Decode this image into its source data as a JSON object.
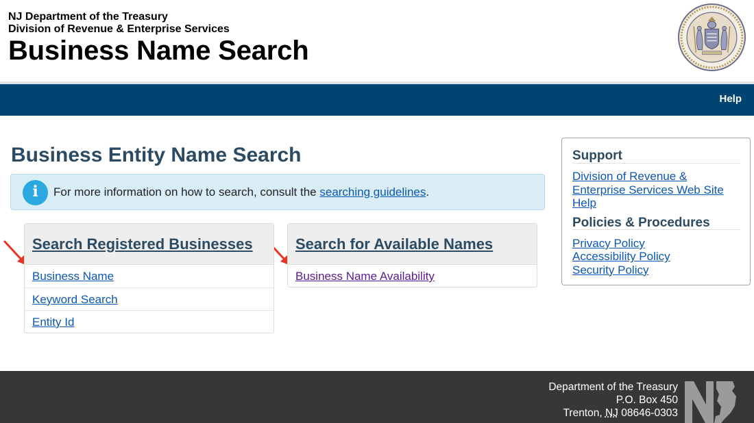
{
  "header": {
    "dept_line1": "NJ Department of the Treasury",
    "dept_line2": "Division of Revenue & Enterprise Services",
    "site_title": "Business Name Search",
    "seal_alt": "Great Seal of the State of New Jersey"
  },
  "nav": {
    "help_label": "Help",
    "bar_color": "#004471"
  },
  "main": {
    "page_heading": "Business Entity Name Search",
    "info": {
      "text_before": "For more information on how to search, consult the ",
      "link_text": "searching guidelines",
      "text_after": ".",
      "icon": "info-icon"
    },
    "registered_panel": {
      "title": "Search Registered Businesses",
      "links": [
        "Business Name",
        "Keyword Search",
        "Entity Id"
      ]
    },
    "available_panel": {
      "title": "Search for Available Names",
      "links": [
        "Business Name Availability"
      ]
    },
    "annotation_arrow_color": "#e53324"
  },
  "sidebar": {
    "support_title": "Support",
    "support_links": [
      "Division of Revenue & Enterprise Services Web Site",
      "Help"
    ],
    "policies_title": "Policies & Procedures",
    "policy_links": [
      "Privacy Policy",
      "Accessibility Policy",
      "Security Policy"
    ]
  },
  "footer": {
    "address_line1": "Department of the Treasury",
    "address_line2": "P.O. Box 450",
    "city": "Trenton, ",
    "state": "NJ",
    "zip": " 08646-0303"
  },
  "colors": {
    "heading": "#2c4b63",
    "link": "#0b57b3",
    "visited_link": "#5b1a8e",
    "footer_bg": "#373737",
    "info_bg": "#d9edf7"
  }
}
